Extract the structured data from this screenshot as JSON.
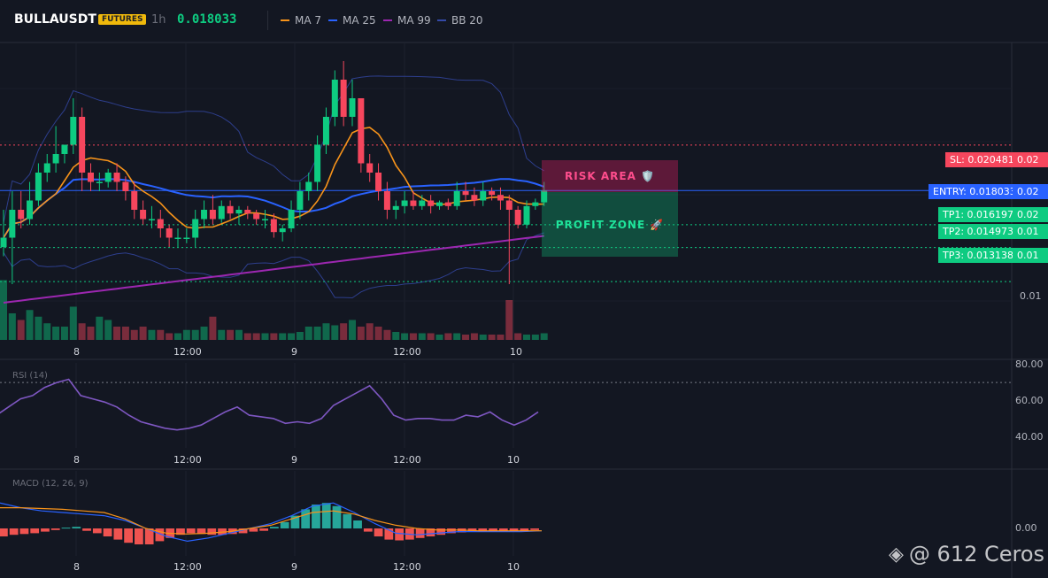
{
  "header": {
    "symbol": "BULLAUSDT",
    "badge": "FUTURES",
    "timeframe": "1h",
    "price": "0.018033",
    "legend": [
      {
        "label": "MA 7",
        "color": "#f7931a"
      },
      {
        "label": "MA 25",
        "color": "#2962ff"
      },
      {
        "label": "MA 99",
        "color": "#9c27b0"
      },
      {
        "label": "BB 20",
        "color": "#3449a8"
      }
    ]
  },
  "levels": {
    "sl": {
      "label": "SL: 0.020481",
      "axis": "0.02"
    },
    "entry": {
      "label": "ENTRY: 0.018033",
      "axis": "0.02"
    },
    "tp1": {
      "label": "TP1: 0.016197",
      "axis": "0.02"
    },
    "tp2": {
      "label": "TP2: 0.014973",
      "axis": "0.01"
    },
    "tp3": {
      "label": "TP3: 0.013138",
      "axis": "0.01"
    }
  },
  "zones": {
    "risk": "RISK AREA 🛡️",
    "profit": "PROFIT ZONE 🚀"
  },
  "price_axis": {
    "low_label": "0.01"
  },
  "time_axis": [
    "8",
    "12:00",
    "9",
    "12:00",
    "10"
  ],
  "rsi": {
    "title": "RSI (14)",
    "ticks": [
      "80.00",
      "60.00",
      "40.00"
    ]
  },
  "macd": {
    "title": "MACD (12, 26, 9)",
    "ticks": [
      "0.00"
    ]
  },
  "watermark": "@ 612 Ceros",
  "chart_data": {
    "type": "candlestick",
    "candles": [
      {
        "o": 0.015,
        "h": 0.017,
        "l": 0.0145,
        "c": 0.0155
      },
      {
        "o": 0.0155,
        "h": 0.018,
        "l": 0.013,
        "c": 0.017
      },
      {
        "o": 0.017,
        "h": 0.018,
        "l": 0.016,
        "c": 0.0165
      },
      {
        "o": 0.0165,
        "h": 0.0185,
        "l": 0.0162,
        "c": 0.0175
      },
      {
        "o": 0.0175,
        "h": 0.0195,
        "l": 0.0172,
        "c": 0.019
      },
      {
        "o": 0.019,
        "h": 0.02,
        "l": 0.0185,
        "c": 0.0195
      },
      {
        "o": 0.0195,
        "h": 0.0215,
        "l": 0.019,
        "c": 0.02
      },
      {
        "o": 0.02,
        "h": 0.0205,
        "l": 0.0195,
        "c": 0.0205
      },
      {
        "o": 0.0205,
        "h": 0.023,
        "l": 0.02,
        "c": 0.022
      },
      {
        "o": 0.022,
        "h": 0.0225,
        "l": 0.018,
        "c": 0.019
      },
      {
        "o": 0.019,
        "h": 0.0195,
        "l": 0.018,
        "c": 0.0185
      },
      {
        "o": 0.0185,
        "h": 0.019,
        "l": 0.018,
        "c": 0.0185
      },
      {
        "o": 0.0185,
        "h": 0.0192,
        "l": 0.0182,
        "c": 0.019
      },
      {
        "o": 0.019,
        "h": 0.0195,
        "l": 0.018,
        "c": 0.0185
      },
      {
        "o": 0.0185,
        "h": 0.0188,
        "l": 0.0175,
        "c": 0.018
      },
      {
        "o": 0.018,
        "h": 0.0185,
        "l": 0.0165,
        "c": 0.017
      },
      {
        "o": 0.017,
        "h": 0.0175,
        "l": 0.0162,
        "c": 0.0165
      },
      {
        "o": 0.0165,
        "h": 0.0172,
        "l": 0.016,
        "c": 0.0165
      },
      {
        "o": 0.0165,
        "h": 0.017,
        "l": 0.0155,
        "c": 0.016
      },
      {
        "o": 0.016,
        "h": 0.0162,
        "l": 0.015,
        "c": 0.0155
      },
      {
        "o": 0.0155,
        "h": 0.016,
        "l": 0.015,
        "c": 0.0155
      },
      {
        "o": 0.0155,
        "h": 0.016,
        "l": 0.0152,
        "c": 0.0155
      },
      {
        "o": 0.0155,
        "h": 0.017,
        "l": 0.015,
        "c": 0.0165
      },
      {
        "o": 0.0165,
        "h": 0.0175,
        "l": 0.016,
        "c": 0.017
      },
      {
        "o": 0.017,
        "h": 0.0178,
        "l": 0.0162,
        "c": 0.0165
      },
      {
        "o": 0.0165,
        "h": 0.0175,
        "l": 0.0163,
        "c": 0.0172
      },
      {
        "o": 0.0172,
        "h": 0.0175,
        "l": 0.0165,
        "c": 0.0168
      },
      {
        "o": 0.0168,
        "h": 0.0172,
        "l": 0.0162,
        "c": 0.017
      },
      {
        "o": 0.017,
        "h": 0.0172,
        "l": 0.0165,
        "c": 0.0168
      },
      {
        "o": 0.0168,
        "h": 0.017,
        "l": 0.0162,
        "c": 0.0165
      },
      {
        "o": 0.0165,
        "h": 0.017,
        "l": 0.016,
        "c": 0.0165
      },
      {
        "o": 0.0165,
        "h": 0.0168,
        "l": 0.0155,
        "c": 0.0158
      },
      {
        "o": 0.0158,
        "h": 0.0162,
        "l": 0.0153,
        "c": 0.016
      },
      {
        "o": 0.016,
        "h": 0.0175,
        "l": 0.0158,
        "c": 0.017
      },
      {
        "o": 0.017,
        "h": 0.0185,
        "l": 0.0165,
        "c": 0.018
      },
      {
        "o": 0.018,
        "h": 0.019,
        "l": 0.0175,
        "c": 0.0185
      },
      {
        "o": 0.0185,
        "h": 0.021,
        "l": 0.018,
        "c": 0.0205
      },
      {
        "o": 0.0205,
        "h": 0.0225,
        "l": 0.02,
        "c": 0.022
      },
      {
        "o": 0.022,
        "h": 0.0245,
        "l": 0.0215,
        "c": 0.024
      },
      {
        "o": 0.024,
        "h": 0.025,
        "l": 0.0215,
        "c": 0.022
      },
      {
        "o": 0.022,
        "h": 0.024,
        "l": 0.0215,
        "c": 0.023
      },
      {
        "o": 0.023,
        "h": 0.023,
        "l": 0.019,
        "c": 0.0195
      },
      {
        "o": 0.0195,
        "h": 0.02,
        "l": 0.0185,
        "c": 0.019
      },
      {
        "o": 0.019,
        "h": 0.0195,
        "l": 0.0175,
        "c": 0.018
      },
      {
        "o": 0.018,
        "h": 0.0185,
        "l": 0.0165,
        "c": 0.017
      },
      {
        "o": 0.017,
        "h": 0.0175,
        "l": 0.0165,
        "c": 0.0172
      },
      {
        "o": 0.0172,
        "h": 0.018,
        "l": 0.0168,
        "c": 0.0175
      },
      {
        "o": 0.0175,
        "h": 0.018,
        "l": 0.017,
        "c": 0.0172
      },
      {
        "o": 0.0172,
        "h": 0.0178,
        "l": 0.017,
        "c": 0.0175
      },
      {
        "o": 0.0175,
        "h": 0.0178,
        "l": 0.0168,
        "c": 0.0172
      },
      {
        "o": 0.0172,
        "h": 0.0175,
        "l": 0.017,
        "c": 0.0174
      },
      {
        "o": 0.0174,
        "h": 0.0176,
        "l": 0.017,
        "c": 0.0172
      },
      {
        "o": 0.0172,
        "h": 0.0185,
        "l": 0.017,
        "c": 0.018
      },
      {
        "o": 0.018,
        "h": 0.0185,
        "l": 0.0175,
        "c": 0.0178
      },
      {
        "o": 0.0178,
        "h": 0.0182,
        "l": 0.0172,
        "c": 0.0175
      },
      {
        "o": 0.0175,
        "h": 0.0185,
        "l": 0.0172,
        "c": 0.018
      },
      {
        "o": 0.018,
        "h": 0.0182,
        "l": 0.0175,
        "c": 0.0178
      },
      {
        "o": 0.0178,
        "h": 0.0182,
        "l": 0.017,
        "c": 0.0175
      },
      {
        "o": 0.0175,
        "h": 0.0178,
        "l": 0.013,
        "c": 0.017
      },
      {
        "o": 0.017,
        "h": 0.0172,
        "l": 0.016,
        "c": 0.0162
      },
      {
        "o": 0.0162,
        "h": 0.0175,
        "l": 0.016,
        "c": 0.0172
      },
      {
        "o": 0.0172,
        "h": 0.0176,
        "l": 0.017,
        "c": 0.0174
      },
      {
        "o": 0.0174,
        "h": 0.0185,
        "l": 0.0172,
        "c": 0.01803
      }
    ],
    "volume": [
      0.9,
      0.4,
      0.3,
      0.45,
      0.35,
      0.25,
      0.2,
      0.2,
      0.5,
      0.25,
      0.2,
      0.35,
      0.3,
      0.2,
      0.2,
      0.15,
      0.2,
      0.15,
      0.15,
      0.1,
      0.1,
      0.15,
      0.15,
      0.2,
      0.35,
      0.15,
      0.15,
      0.15,
      0.1,
      0.1,
      0.1,
      0.1,
      0.1,
      0.1,
      0.12,
      0.2,
      0.2,
      0.25,
      0.22,
      0.25,
      0.3,
      0.2,
      0.25,
      0.2,
      0.15,
      0.12,
      0.1,
      0.1,
      0.1,
      0.1,
      0.08,
      0.1,
      0.1,
      0.08,
      0.1,
      0.08,
      0.08,
      0.08,
      0.6,
      0.1,
      0.08,
      0.08,
      0.1
    ],
    "rsi": [
      50,
      55,
      60,
      62,
      67,
      70,
      72,
      62,
      60,
      58,
      55,
      50,
      46,
      44,
      42,
      41,
      42,
      44,
      48,
      52,
      55,
      50,
      49,
      48,
      45,
      46,
      45,
      48,
      56,
      60,
      64,
      68,
      60,
      50,
      47,
      48,
      48,
      47,
      47,
      50,
      49,
      52,
      47,
      44,
      47,
      52
    ],
    "macd_hist": [
      -0.5,
      -0.4,
      -0.35,
      -0.3,
      -0.2,
      -0.1,
      0.05,
      0.1,
      -0.15,
      -0.3,
      -0.5,
      -0.7,
      -0.9,
      -1.0,
      -1.0,
      -0.8,
      -0.6,
      -0.4,
      -0.3,
      -0.35,
      -0.4,
      -0.4,
      -0.35,
      -0.3,
      -0.2,
      -0.15,
      0.1,
      0.4,
      0.8,
      1.2,
      1.5,
      1.6,
      1.4,
      0.9,
      0.5,
      -0.2,
      -0.5,
      -0.7,
      -0.75,
      -0.7,
      -0.6,
      -0.5,
      -0.4,
      -0.3,
      -0.25,
      -0.2,
      -0.2,
      -0.2,
      -0.2,
      -0.2,
      -0.15,
      -0.1
    ],
    "macd_line": [
      1.6,
      1.3,
      1.1,
      1.0,
      0.9,
      0.8,
      0.5,
      0.0,
      -0.5,
      -0.8,
      -0.6,
      -0.3,
      0.0,
      0.3,
      0.8,
      1.4,
      1.6,
      1.0,
      0.3,
      -0.3,
      -0.4,
      -0.3,
      -0.2,
      -0.2,
      -0.2,
      -0.2,
      -0.15
    ],
    "signal_line": [
      1.3,
      1.3,
      1.25,
      1.2,
      1.1,
      1.0,
      0.6,
      0.0,
      -0.3,
      -0.35,
      -0.3,
      -0.2,
      0.0,
      0.2,
      0.6,
      1.0,
      1.1,
      0.9,
      0.5,
      0.2,
      0.0,
      -0.1,
      -0.1,
      -0.15,
      -0.15,
      -0.15,
      -0.15
    ],
    "levels": {
      "sl": 0.020481,
      "entry": 0.018033,
      "tp1": 0.016197,
      "tp2": 0.014973,
      "tp3": 0.013138
    },
    "rsi_range": [
      30,
      82
    ],
    "price_range": [
      0.01,
      0.026
    ]
  }
}
